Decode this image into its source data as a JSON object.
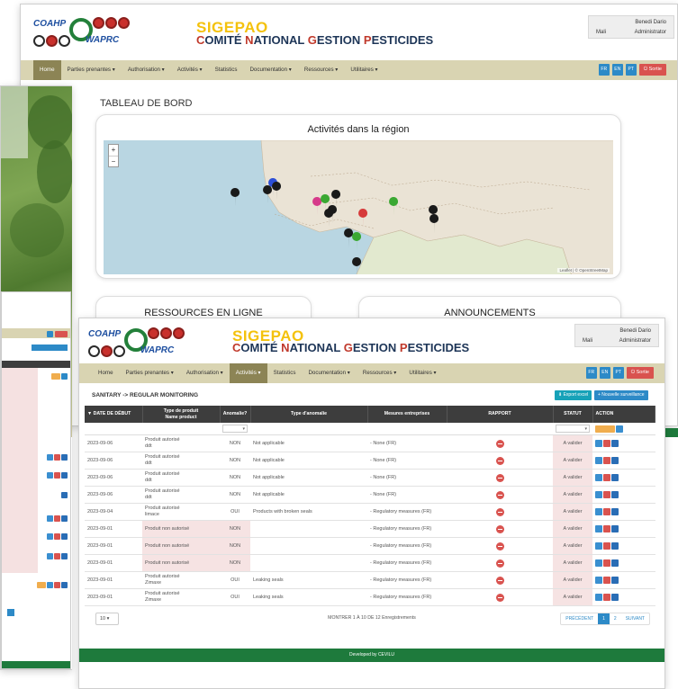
{
  "brand": {
    "logo_top": "COAHP",
    "logo_bottom": "WAPRC",
    "app_name": "SIGEPAO",
    "subtitle_c": "C",
    "subtitle_1": "OMITÉ ",
    "subtitle_n": "N",
    "subtitle_2": "ATIONAL ",
    "subtitle_g": "G",
    "subtitle_3": "ESTION ",
    "subtitle_p": "P",
    "subtitle_4": "ESTICIDES"
  },
  "user": {
    "name": "Benedi Dario",
    "country": "Mali",
    "role": "Administrator"
  },
  "nav": {
    "items": [
      {
        "label": "Home"
      },
      {
        "label": "Parties prenantes ▾"
      },
      {
        "label": "Authorisation ▾"
      },
      {
        "label": "Activités ▾"
      },
      {
        "label": "Statistics"
      },
      {
        "label": "Documentation ▾"
      },
      {
        "label": "Ressources ▾"
      },
      {
        "label": "Utilitaires ▾"
      }
    ],
    "langs": [
      "FR",
      "EN",
      "PT"
    ],
    "logout": "⏻ Sortie"
  },
  "dashboard": {
    "title": "TABLEAU DE BORD",
    "map_title": "Activités dans la région",
    "map_attribution": "Leaflet | © OpenStreetMap",
    "card_resources": "RESSOURCES EN LIGNE",
    "card_announcements": "ANNOUNCEMENTS",
    "pin_colors": {
      "black": "#1a1a1a",
      "green": "#3aa832",
      "red": "#d63a3a",
      "pink": "#d63a8a",
      "blue": "#2d4fd6"
    }
  },
  "monitoring": {
    "page_title": "SANITARY -> REGULAR MONITORING",
    "export_label": "⬇ Export excel",
    "new_label": "+ Nouvelle surveillance",
    "columns": [
      "▼ DATE DE DÉBUT",
      "Type de produit\nName product",
      "Anomalie?",
      "Type d'anomalie",
      "Mesures entreprises",
      "RAPPORT",
      "STATUT",
      "ACTION"
    ],
    "rows": [
      {
        "date": "2023-09-06",
        "product": "Produit autorisé\nddt",
        "anomaly": "NON",
        "type": "Not applicable",
        "measures": "- None (FR)",
        "status": "A valider",
        "pink": false
      },
      {
        "date": "2023-09-06",
        "product": "Produit autorisé\nddt",
        "anomaly": "NON",
        "type": "Not applicable",
        "measures": "- None (FR)",
        "status": "A valider",
        "pink": false
      },
      {
        "date": "2023-09-06",
        "product": "Produit autorisé\nddt",
        "anomaly": "NON",
        "type": "Not applicable",
        "measures": "- None (FR)",
        "status": "A valider",
        "pink": false
      },
      {
        "date": "2023-09-06",
        "product": "Produit autorisé\nddt",
        "anomaly": "NON",
        "type": "Not applicable",
        "measures": "- None (FR)",
        "status": "A valider",
        "pink": false
      },
      {
        "date": "2023-09-04",
        "product": "Produit autorisé\nlimace",
        "anomaly": "OUI",
        "type": "Products with broken seals",
        "measures": "- Regulatory measures (FR)",
        "status": "A valider",
        "pink": false
      },
      {
        "date": "2023-09-01",
        "product": "Produit non autorisé",
        "anomaly": "NON",
        "type": "",
        "measures": "- Regulatory measures (FR)",
        "status": "A valider",
        "pink": true
      },
      {
        "date": "2023-09-01",
        "product": "Produit non autorisé",
        "anomaly": "NON",
        "type": "",
        "measures": "- Regulatory measures (FR)",
        "status": "A valider",
        "pink": true
      },
      {
        "date": "2023-09-01",
        "product": "Produit non autorisé",
        "anomaly": "NON",
        "type": "",
        "measures": "- Regulatory measures (FR)",
        "status": "A valider",
        "pink": true
      },
      {
        "date": "2023-09-01",
        "product": "Produit autorisé\nZimaxe",
        "anomaly": "OUI",
        "type": "Leaking seals",
        "measures": "- Regulatory measures (FR)",
        "status": "A valider",
        "pink": false
      },
      {
        "date": "2023-09-01",
        "product": "Produit autorisé\nZimaxe",
        "anomaly": "OUI",
        "type": "Leaking seals",
        "measures": "- Regulatory measures (FR)",
        "status": "A valider",
        "pink": false
      }
    ],
    "page_size": "10",
    "showing": "MONTRER 1 À 10 DE 12 Enregistrements",
    "pager": {
      "prev": "PRÉCÉDENT",
      "p1": "1",
      "p2": "2",
      "next": "SUIVANT"
    },
    "footer": "Developed by CEVILU"
  }
}
